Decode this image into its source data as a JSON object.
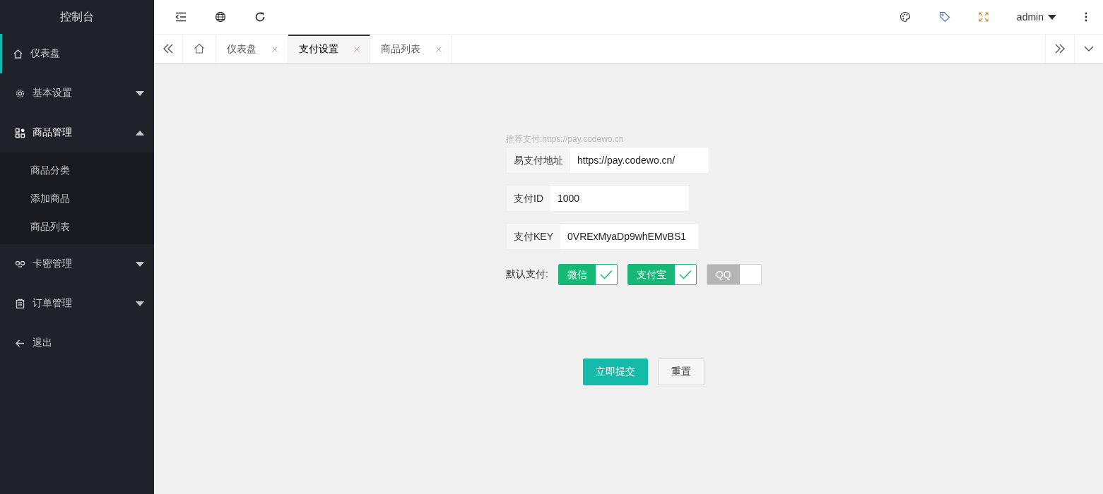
{
  "sidebar": {
    "title": "控制台",
    "items": [
      {
        "label": "仪表盘",
        "selected": true
      },
      {
        "label": "基本设置",
        "expanded": false,
        "selected": false
      },
      {
        "label": "商品管理",
        "expanded": true,
        "selected": false,
        "children": [
          {
            "label": "商品分类",
            "selected": false
          },
          {
            "label": "添加商品",
            "selected": false
          },
          {
            "label": "商品列表",
            "selected": false
          }
        ]
      },
      {
        "label": "卡密管理",
        "expanded": false,
        "selected": false
      },
      {
        "label": "订单管理",
        "expanded": false,
        "selected": false
      },
      {
        "label": "退出",
        "selected": false
      }
    ]
  },
  "header": {
    "user": "admin"
  },
  "tabs": [
    {
      "label": "仪表盘",
      "selected": false
    },
    {
      "label": "支付设置",
      "selected": true
    },
    {
      "label": "商品列表",
      "selected": false
    }
  ],
  "form": {
    "hint": "推荐支付:https://pay.codewo.cn",
    "fields": [
      {
        "label": "易支付地址",
        "value": "https://pay.codewo.cn/"
      },
      {
        "label": "支付ID",
        "value": "1000"
      },
      {
        "label": "支付KEY",
        "value": "0VRExMyaDp9whEMvBS1"
      }
    ],
    "default_pay": {
      "label": "默认支付:",
      "options": [
        {
          "label": "微信",
          "checked": true
        },
        {
          "label": "支付宝",
          "checked": true
        },
        {
          "label": "QQ",
          "checked": false
        }
      ]
    },
    "buttons": [
      {
        "label": "立即提交",
        "kind": "primary"
      },
      {
        "label": "重置",
        "kind": "plain"
      }
    ]
  }
}
